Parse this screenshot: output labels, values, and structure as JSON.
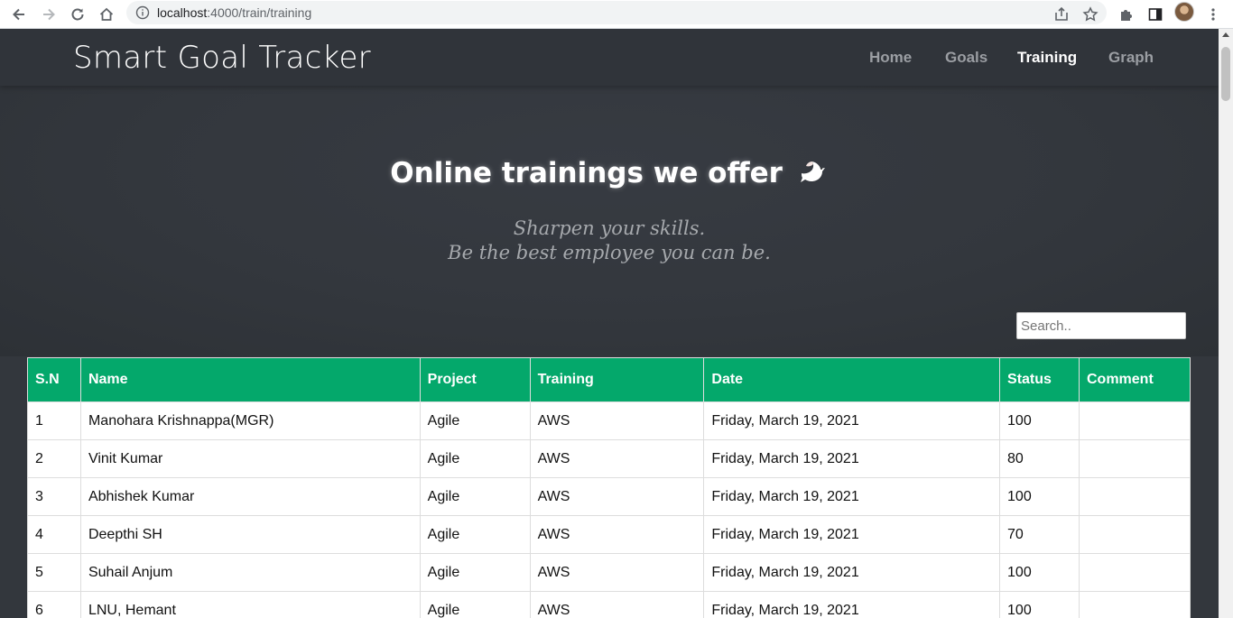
{
  "browser": {
    "url_host": "localhost",
    "url_path": ":4000/train/training"
  },
  "nav": {
    "brand": "Smart Goal Tracker",
    "items": [
      {
        "label": "Home",
        "active": false
      },
      {
        "label": "Goals",
        "active": false
      },
      {
        "label": "Training",
        "active": true
      },
      {
        "label": "Graph",
        "active": false
      }
    ]
  },
  "hero": {
    "title": "Online trainings we offer",
    "title_icon": "dove-icon",
    "subtitle_line1": "Sharpen your skills.",
    "subtitle_line2": "Be the best employee you can be."
  },
  "search": {
    "placeholder": "Search..",
    "value": ""
  },
  "table": {
    "headers": [
      "S.N",
      "Name",
      "Project",
      "Training",
      "Date",
      "Status",
      "Comment"
    ],
    "rows": [
      {
        "sn": "1",
        "name": "Manohara Krishnappa(MGR)",
        "project": "Agile",
        "training": "AWS",
        "date": "Friday, March 19, 2021",
        "status": "100",
        "comment": ""
      },
      {
        "sn": "2",
        "name": "Vinit Kumar",
        "project": "Agile",
        "training": "AWS",
        "date": "Friday, March 19, 2021",
        "status": "80",
        "comment": ""
      },
      {
        "sn": "3",
        "name": "Abhishek Kumar",
        "project": "Agile",
        "training": "AWS",
        "date": "Friday, March 19, 2021",
        "status": "100",
        "comment": ""
      },
      {
        "sn": "4",
        "name": "Deepthi SH",
        "project": "Agile",
        "training": "AWS",
        "date": "Friday, March 19, 2021",
        "status": "70",
        "comment": ""
      },
      {
        "sn": "5",
        "name": "Suhail Anjum",
        "project": "Agile",
        "training": "AWS",
        "date": "Friday, March 19, 2021",
        "status": "100",
        "comment": ""
      },
      {
        "sn": "6",
        "name": "LNU, Hemant",
        "project": "Agile",
        "training": "AWS",
        "date": "Friday, March 19, 2021",
        "status": "100",
        "comment": ""
      }
    ]
  },
  "colors": {
    "header_green": "#04a86b",
    "page_bg": "#33373d"
  }
}
